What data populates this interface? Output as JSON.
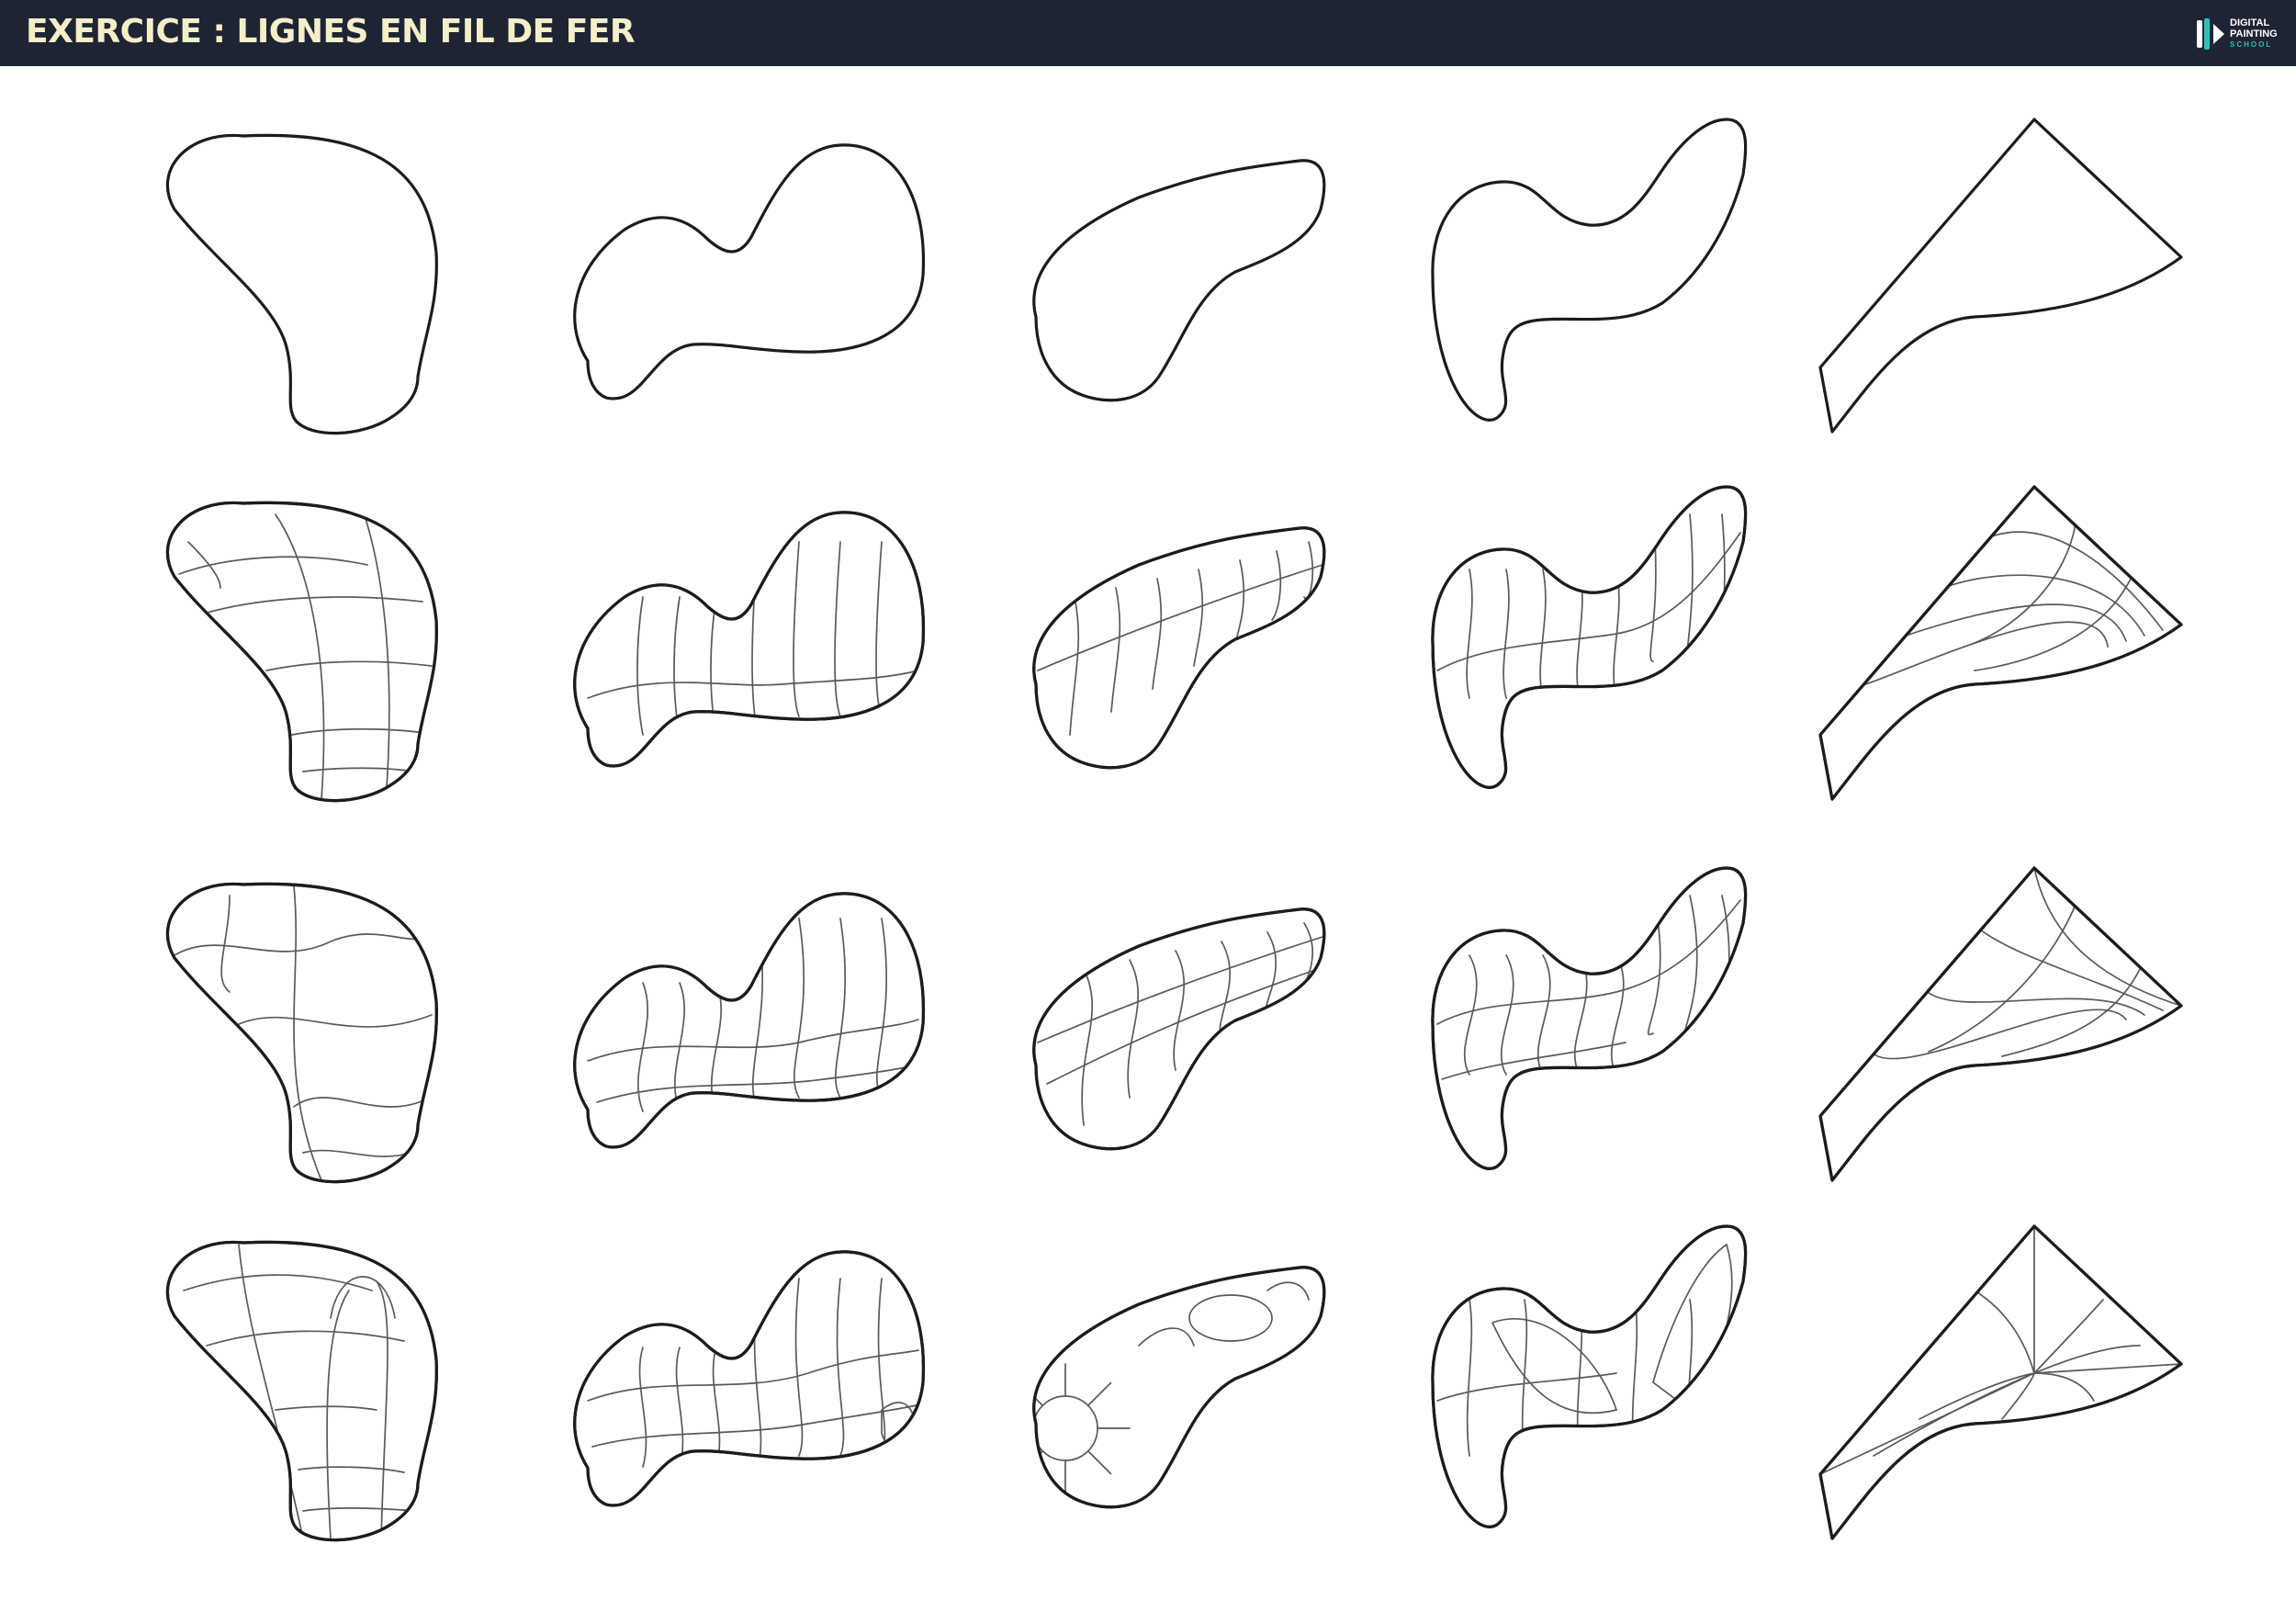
{
  "header": {
    "title": "EXERCICE : LIGNES EN FIL DE FER",
    "background_color": "#1e2433",
    "title_color": "#f4efc8"
  },
  "logo": {
    "icon": "brush-pen-icon",
    "line1": "DIGITAL",
    "line2": "PAINTING",
    "line3": "SCHOOL",
    "accent_color": "#2fc1b7"
  },
  "sheet": {
    "columns": [
      {
        "shape": "rounded-pear-blob"
      },
      {
        "shape": "double-hump-blob"
      },
      {
        "shape": "slanted-bean-blob"
      },
      {
        "shape": "s-curve-hook-blob"
      },
      {
        "shape": "curved-triangle-wedge"
      }
    ],
    "rows": [
      {
        "style": "outline-only"
      },
      {
        "style": "parallel-wireframe"
      },
      {
        "style": "crossing-wireframe"
      },
      {
        "style": "complex-wireframe"
      }
    ],
    "outline_color": "#1c1c1c",
    "wire_color": "#5a5a5a"
  }
}
